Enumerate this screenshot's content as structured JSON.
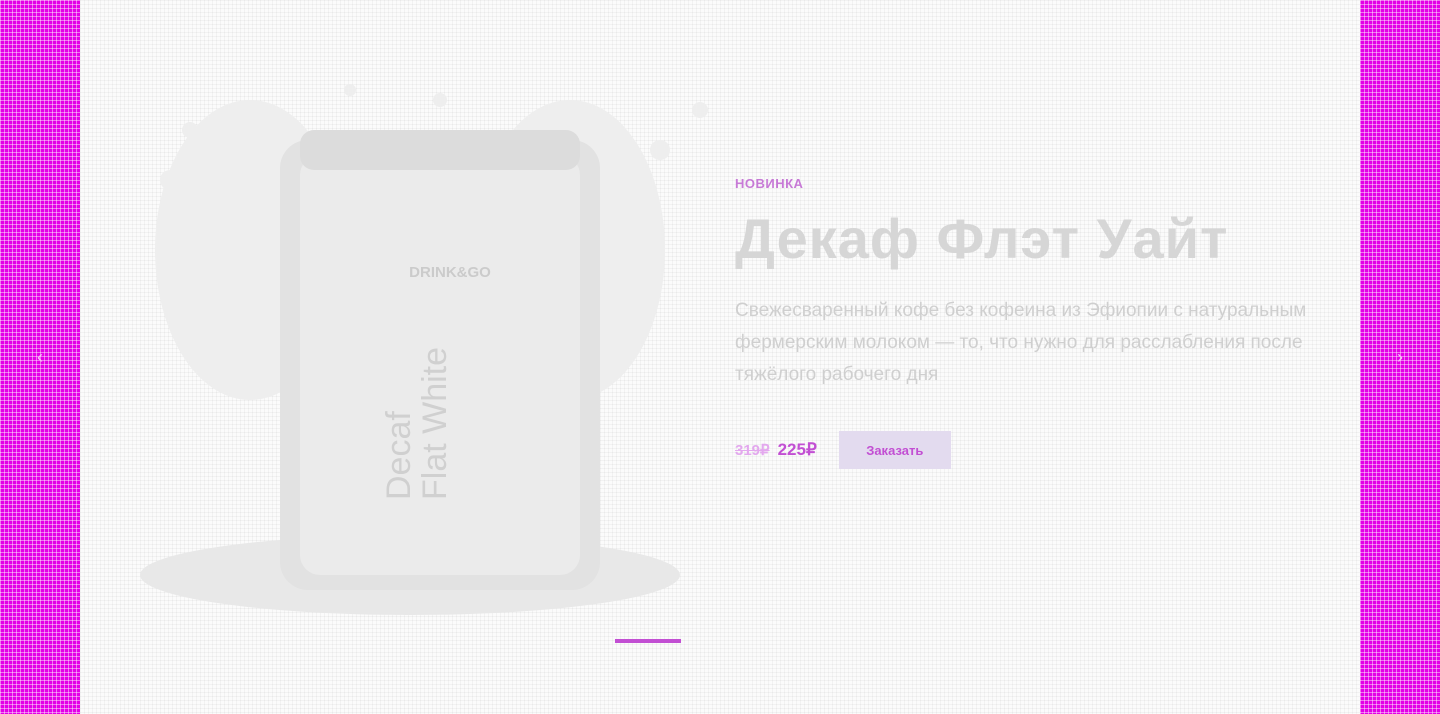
{
  "nav": {
    "prev_icon": "chevron-left-icon",
    "prev_glyph": "‹",
    "next_icon": "chevron-right-icon",
    "next_glyph": "›"
  },
  "slide": {
    "tag": "НОВИНКА",
    "title": "Декаф Флэт Уайт",
    "description": "Свежесваренный кофе без кофеина из Эфиопии с натуральным фермерским молоком — то, что нужно для расслабления после тяжёлого рабочего дня",
    "price_old": "319₽",
    "price_new": "225₽",
    "order_label": "Заказать",
    "product": {
      "brand": "DRINK&GO",
      "name_line1": "Decaf",
      "name_line2": "Flat White"
    }
  },
  "pagination": {
    "count": 1,
    "active": 0
  },
  "colors": {
    "accent": "#c24fd3",
    "side_band": "#e300e6",
    "button_bg": "#e3dbef"
  }
}
